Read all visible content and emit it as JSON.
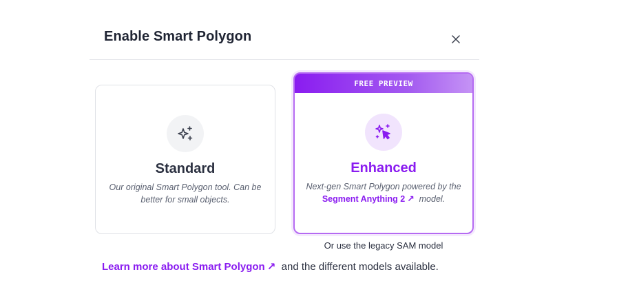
{
  "dialog": {
    "title": "Enable Smart Polygon",
    "close_icon": "close-icon"
  },
  "standard": {
    "name": "Standard",
    "description": "Our original Smart Polygon tool. Can be better for small objects.",
    "icon": "sparkles-icon"
  },
  "enhanced": {
    "banner": "FREE PREVIEW",
    "name": "Enhanced",
    "description_before": "Next-gen Smart Polygon powered by the",
    "link_label": "Segment Anything 2",
    "link_arrow": "↗",
    "description_after": "model.",
    "icon": "sparkle-cursor-icon"
  },
  "legacy_label": "Or use the legacy SAM model",
  "footer": {
    "link_label": "Learn more about Smart Polygon",
    "link_arrow": "↗",
    "text": "and the different models available."
  },
  "colors": {
    "accent": "#8a1cf0",
    "text": "#1f2433",
    "muted": "#5a6070"
  }
}
